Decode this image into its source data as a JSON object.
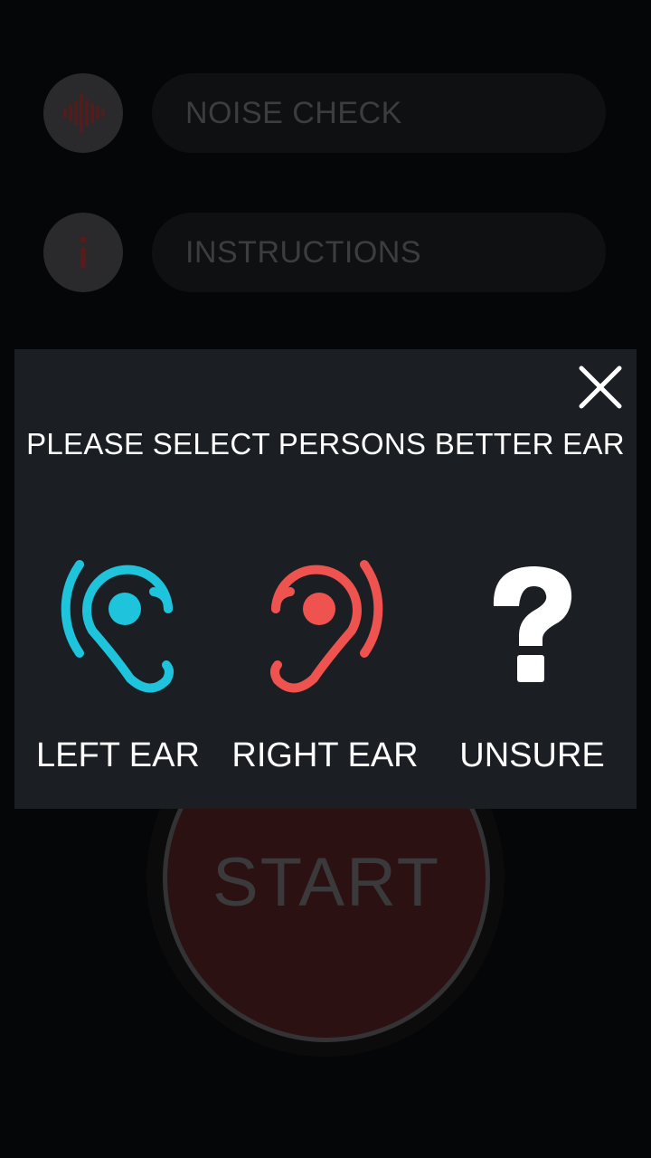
{
  "menu": {
    "noise_check": {
      "label": "NOISE CHECK",
      "icon": "sound-wave-icon"
    },
    "instructions": {
      "label": "INSTRUCTIONS",
      "icon": "info-icon"
    }
  },
  "start_button": {
    "label": "START"
  },
  "dialog": {
    "title": "PLEASE SELECT PERSONS BETTER EAR",
    "close_icon": "close-icon",
    "options": [
      {
        "label": "LEFT EAR",
        "icon": "left-ear-icon",
        "color": "#1ec3dc"
      },
      {
        "label": "RIGHT EAR",
        "icon": "right-ear-icon",
        "color": "#ef5350"
      },
      {
        "label": "UNSURE",
        "icon": "question-mark-icon",
        "color": "#ffffff"
      }
    ]
  },
  "colors": {
    "accent_red": "#ef5350",
    "accent_cyan": "#1ec3dc",
    "dialog_bg": "#1b1f24",
    "screen_bg": "#050608"
  }
}
